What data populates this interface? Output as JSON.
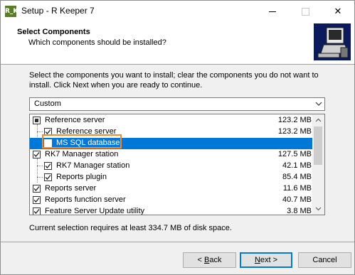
{
  "window": {
    "icon_text": "R_K",
    "title": "Setup - R Keeper 7",
    "min_label": "—",
    "max_label": "☐",
    "close_label": "✕"
  },
  "header": {
    "title": "Select Components",
    "subtitle": "Which components should be installed?"
  },
  "intro": "Select the components you want to install; clear the components you do not want to install. Click Next when you are ready to continue.",
  "setup_type": {
    "selected": "Custom"
  },
  "components": [
    {
      "label": "Reference server",
      "size": "123.2 MB",
      "state": "partial",
      "level": 0,
      "selected": false
    },
    {
      "label": "Reference server",
      "size": "123.2 MB",
      "state": "checked",
      "level": 1,
      "selected": false
    },
    {
      "label": "MS SQL database",
      "size": "",
      "state": "unchecked",
      "level": 1,
      "selected": true
    },
    {
      "label": "RK7 Manager station",
      "size": "127.5 MB",
      "state": "checked",
      "level": 0,
      "selected": false
    },
    {
      "label": "RK7 Manager station",
      "size": "42.1 MB",
      "state": "checked",
      "level": 1,
      "selected": false
    },
    {
      "label": "Reports plugin",
      "size": "85.4 MB",
      "state": "checked",
      "level": 1,
      "selected": false
    },
    {
      "label": "Reports server",
      "size": "11.6 MB",
      "state": "checked",
      "level": 0,
      "selected": false
    },
    {
      "label": "Reports function server",
      "size": "40.7 MB",
      "state": "checked",
      "level": 0,
      "selected": false
    },
    {
      "label": "Feature Server Update utility",
      "size": "3.8 MB",
      "state": "checked",
      "level": 0,
      "selected": false
    }
  ],
  "disk_space": "Current selection requires at least 334.7 MB of disk space.",
  "buttons": {
    "back": {
      "accel": "B",
      "rest": "ack",
      "prefix": "< "
    },
    "next": {
      "accel": "N",
      "rest": "ext >"
    },
    "cancel": "Cancel"
  },
  "colors": {
    "selection": "#0078d7",
    "highlight_outline": "#f08a2a"
  }
}
